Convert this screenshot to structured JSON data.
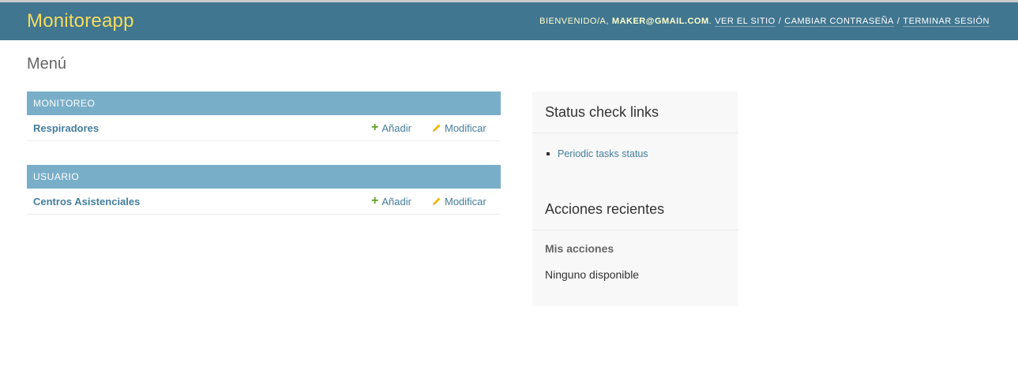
{
  "header": {
    "brand": "Monitoreapp",
    "welcome": "BIENVENIDO/A,",
    "user": "MAKER@GMAIL.COM",
    "after_user": ".",
    "view_site": "VER EL SITIO",
    "sep": "/",
    "change_password": "CAMBIAR CONTRASEÑA",
    "logout": "TERMINAR SESIÓN",
    "colors": {
      "bar": "#417690",
      "brand": "#f5dd5d"
    }
  },
  "page": {
    "title": "Menú"
  },
  "modules": [
    {
      "caption": "MONITOREO",
      "rows": [
        {
          "name": "Respiradores",
          "add": "Añadir",
          "change": "Modificar"
        }
      ]
    },
    {
      "caption": "USUARIO",
      "rows": [
        {
          "name": "Centros Asistenciales",
          "add": "Añadir",
          "change": "Modificar"
        }
      ]
    }
  ],
  "sidebar": {
    "status_title": "Status check links",
    "status_links": [
      "Periodic tasks status"
    ],
    "recent_title": "Acciones recientes",
    "mine_title": "Mis acciones",
    "none_text": "Ninguno disponible"
  },
  "icons": {
    "add": "plus-icon",
    "change": "pencil-icon",
    "bullet": "square-bullet-icon"
  }
}
